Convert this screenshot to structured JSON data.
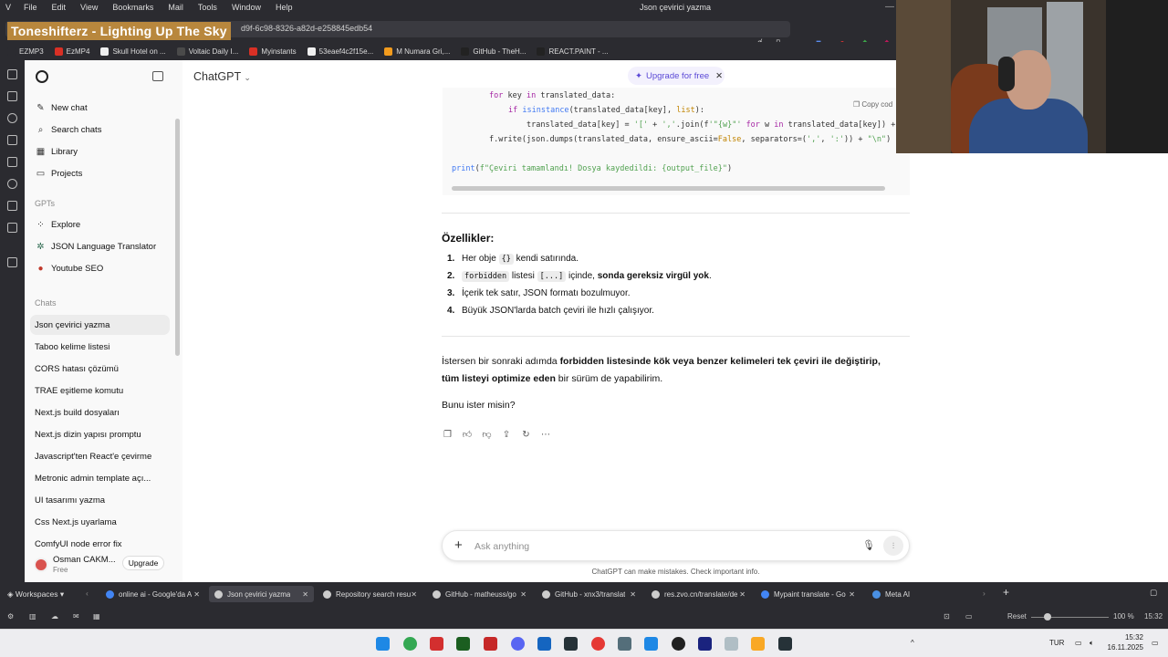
{
  "browser": {
    "menu": [
      "File",
      "Edit",
      "View",
      "Bookmarks",
      "Mail",
      "Tools",
      "Window",
      "Help"
    ],
    "window_title": "Json çevirici yazma",
    "overlay_title": "Toneshifterz - Lighting Up The Sky",
    "url_visible": "d9f-6c98-8326-a82d-e258845edb54",
    "bookmarks": [
      {
        "label": "EZMP3",
        "color": "#2b2b30"
      },
      {
        "label": "EzMP4",
        "color": "#d93025"
      },
      {
        "label": "Skull Hotel on ...",
        "color": "#eeeeee"
      },
      {
        "label": "Voltaic Daily I...",
        "color": "#4a4a4a"
      },
      {
        "label": "Myinstants",
        "color": "#d93025"
      },
      {
        "label": "53eaef4c2f15e...",
        "color": "#f0f0f0"
      },
      {
        "label": "M Numara Gri,...",
        "color": "#f29b1d"
      },
      {
        "label": "GitHub - TheH...",
        "color": "#222222"
      },
      {
        "label": "REACT.PAINT - ...",
        "color": "#222222"
      }
    ]
  },
  "sidebar": {
    "top_items": [
      {
        "label": "New chat",
        "icon": "edit-icon"
      },
      {
        "label": "Search chats",
        "icon": "search-icon"
      },
      {
        "label": "Library",
        "icon": "library-icon"
      },
      {
        "label": "Projects",
        "icon": "folder-icon"
      }
    ],
    "gpts_label": "GPTs",
    "gpts": [
      {
        "label": "Explore",
        "icon": "grid-icon"
      },
      {
        "label": "JSON Language Translator",
        "icon": "gpt-icon"
      },
      {
        "label": "Youtube SEO",
        "icon": "gpt-icon"
      }
    ],
    "chats_label": "Chats",
    "chats": [
      "Json çevirici yazma",
      "Taboo kelime listesi",
      "CORS hatası çözümü",
      "TRAE eşitleme komutu",
      "Next.js build dosyaları",
      "Next.js dizin yapısı promptu",
      "Javascript'ten React'e çevirme",
      "Metronic admin template açı...",
      "UI tasarımı yazma",
      "Css Next.js uyarlama",
      "ComfyUI node error fix"
    ],
    "user": {
      "name": "Osman CAKM...",
      "plan": "Free",
      "upgrade_label": "Upgrade"
    }
  },
  "main": {
    "model_label": "ChatGPT",
    "upgrade_pill": "Upgrade for free",
    "copy_code": "Copy cod",
    "code_lines": [
      "for key in translated_data:",
      "if isinstance(translated_data[key], list):",
      "translated_data[key] = '[' + ','.join(f'\"{w}\"' for w in translated_data[key]) +",
      "f.write(json.dumps(translated_data, ensure_ascii=False, separators=(',', ':')) + \"\\n\")",
      "print(f\"Çeviri tamamlandı! Dosya kaydedildi: {output_file}\")"
    ],
    "features_title": "Özellikler:",
    "features": [
      {
        "num": "1.",
        "pre": "Her obje ",
        "code": "{}",
        "post": " kendi satırında."
      },
      {
        "num": "2.",
        "pre": "",
        "code": "forbidden",
        "mid": " listesi ",
        "code2": "[...]",
        "mid2": " içinde, ",
        "bold": "sonda gereksiz virgül yok",
        "post": "."
      },
      {
        "num": "3.",
        "pre": "İçerik tek satır, JSON formatı bozulmuyor."
      },
      {
        "num": "4.",
        "pre": "Büyük JSON'larda batch çeviri ile hızlı çalışıyor."
      }
    ],
    "para1_pre": "İstersen bir sonraki adımda ",
    "para1_bold": "forbidden listesinde kök veya benzer kelimeleri tek çeviri ile değiştirip, tüm listeyi optimize eden",
    "para1_post": " bir sürüm de yapabilirim.",
    "para2": "Bunu ister misin?",
    "composer_placeholder": "Ask anything",
    "disclaimer": "ChatGPT can make mistakes. Check important info."
  },
  "tabs": {
    "workspaces": "Workspaces",
    "items": [
      {
        "label": "online ai - Google'da A",
        "color": "#4285f4",
        "active": false
      },
      {
        "label": "Json çevirici yazma",
        "color": "#cccccc",
        "active": true
      },
      {
        "label": "Repository search resu",
        "color": "#cccccc",
        "active": false
      },
      {
        "label": "GitHub - matheuss/go",
        "color": "#cccccc",
        "active": false
      },
      {
        "label": "GitHub - xnx3/translat",
        "color": "#cccccc",
        "active": false
      },
      {
        "label": "res.zvo.cn/translate/de",
        "color": "#cccccc",
        "active": false
      },
      {
        "label": "Mypaint translate - Go",
        "color": "#4285f4",
        "active": false
      },
      {
        "label": "Meta AI",
        "color": "#4a90e2",
        "active": false
      }
    ]
  },
  "status": {
    "reset": "Reset",
    "zoom": "100 %",
    "time": "15:32"
  },
  "taskbar": {
    "lang": "TUR",
    "time": "15:32",
    "date": "16.11.2025"
  }
}
